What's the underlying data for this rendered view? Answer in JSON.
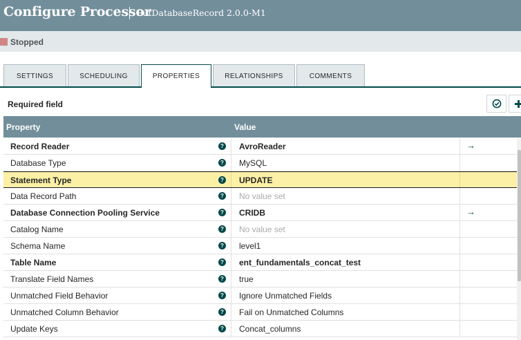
{
  "header": {
    "title": "Configure Processor",
    "subtitle": "PutDatabaseRecord 2.0.0-M1"
  },
  "status": {
    "label": "Stopped",
    "color": "#d18686"
  },
  "tabs": [
    {
      "label": "SETTINGS",
      "active": false
    },
    {
      "label": "SCHEDULING",
      "active": false
    },
    {
      "label": "PROPERTIES",
      "active": true
    },
    {
      "label": "RELATIONSHIPS",
      "active": false
    },
    {
      "label": "COMMENTS",
      "active": false
    }
  ],
  "properties_panel": {
    "required_label": "Required field",
    "verify_icon": "check-circle-icon",
    "add_icon": "plus-icon"
  },
  "table": {
    "columns": [
      "Property",
      "Value"
    ],
    "rows": [
      {
        "name": "Record Reader",
        "value": "AvroReader",
        "required": true,
        "goto": true
      },
      {
        "name": "Database Type",
        "value": "MySQL",
        "required": false
      },
      {
        "name": "Statement Type",
        "value": "UPDATE",
        "required": true,
        "selected": true
      },
      {
        "name": "Data Record Path",
        "value": "No value set",
        "required": false,
        "empty": true
      },
      {
        "name": "Database Connection Pooling Service",
        "value": "CRIDB",
        "required": true,
        "goto": true
      },
      {
        "name": "Catalog Name",
        "value": "No value set",
        "required": false,
        "empty": true
      },
      {
        "name": "Schema Name",
        "value": "level1",
        "required": false
      },
      {
        "name": "Table Name",
        "value": "ent_fundamentals_concat_test",
        "required": true
      },
      {
        "name": "Translate Field Names",
        "value": "true",
        "required": false
      },
      {
        "name": "Unmatched Field Behavior",
        "value": "Ignore Unmatched Fields",
        "required": false
      },
      {
        "name": "Unmatched Column Behavior",
        "value": "Fail on Unmatched Columns",
        "required": false
      },
      {
        "name": "Update Keys",
        "value": "Concat_columns",
        "required": false
      }
    ],
    "info_glyph": "?",
    "goto_glyph": "→"
  }
}
